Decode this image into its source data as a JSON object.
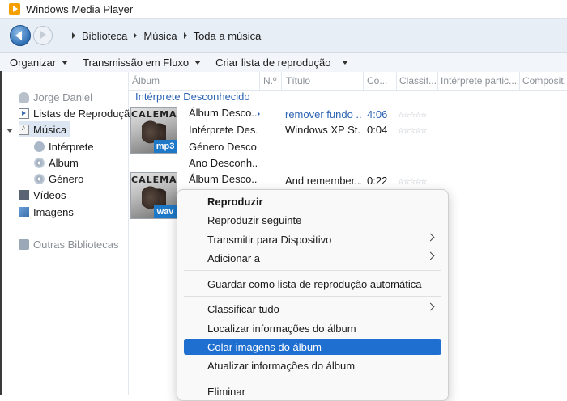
{
  "window": {
    "title": "Windows Media Player"
  },
  "breadcrumb": [
    "Biblioteca",
    "Música",
    "Toda a música"
  ],
  "toolbar": {
    "organize": "Organizar",
    "stream": "Transmissão em Fluxo",
    "create_playlist": "Criar lista de reprodução"
  },
  "nav": {
    "user": "Jorge Daniel",
    "playlists": "Listas de Reprodução",
    "music": "Música",
    "artist": "Intérprete",
    "album": "Álbum",
    "genre": "Género",
    "videos": "Vídeos",
    "images": "Imagens",
    "other_libraries": "Outras Bibliotecas"
  },
  "columns": [
    "Álbum",
    "N.º",
    "Título",
    "Co...",
    "Classif...",
    "Intérprete partic...",
    "Composit..."
  ],
  "group_title": "Intérprete Desconhecido",
  "albums": [
    {
      "band": "CALEMA",
      "badge": "mp3",
      "info": [
        "Álbum Desco...",
        "Intérprete Des...",
        "Género Desco...",
        "Ano Desconh..."
      ],
      "tracks": [
        {
          "title": "remover fundo ...",
          "length": "4:06",
          "highlight": true
        },
        {
          "title": "Windows XP St...",
          "length": "0:04",
          "highlight": false
        }
      ]
    },
    {
      "band": "CALEMA",
      "badge": "wav",
      "info": [
        "Álbum Desco..."
      ],
      "tracks": [
        {
          "title": "And remember...",
          "length": "0:22",
          "highlight": false
        }
      ]
    }
  ],
  "context_menu": {
    "play": "Reproduzir",
    "play_next": "Reproduzir seguinte",
    "cast": "Transmitir para Dispositivo",
    "add_to": "Adicionar a",
    "save_auto": "Guardar como lista de reprodução automática",
    "sort_all": "Classificar tudo",
    "find_info": "Localizar informações do álbum",
    "paste_art": "Colar imagens do álbum",
    "update_info": "Atualizar informações do álbum",
    "delete": "Eliminar"
  },
  "colors": {
    "accent": "#1f6fd1",
    "link": "#2b63b3",
    "badge": "#1e78c8"
  }
}
